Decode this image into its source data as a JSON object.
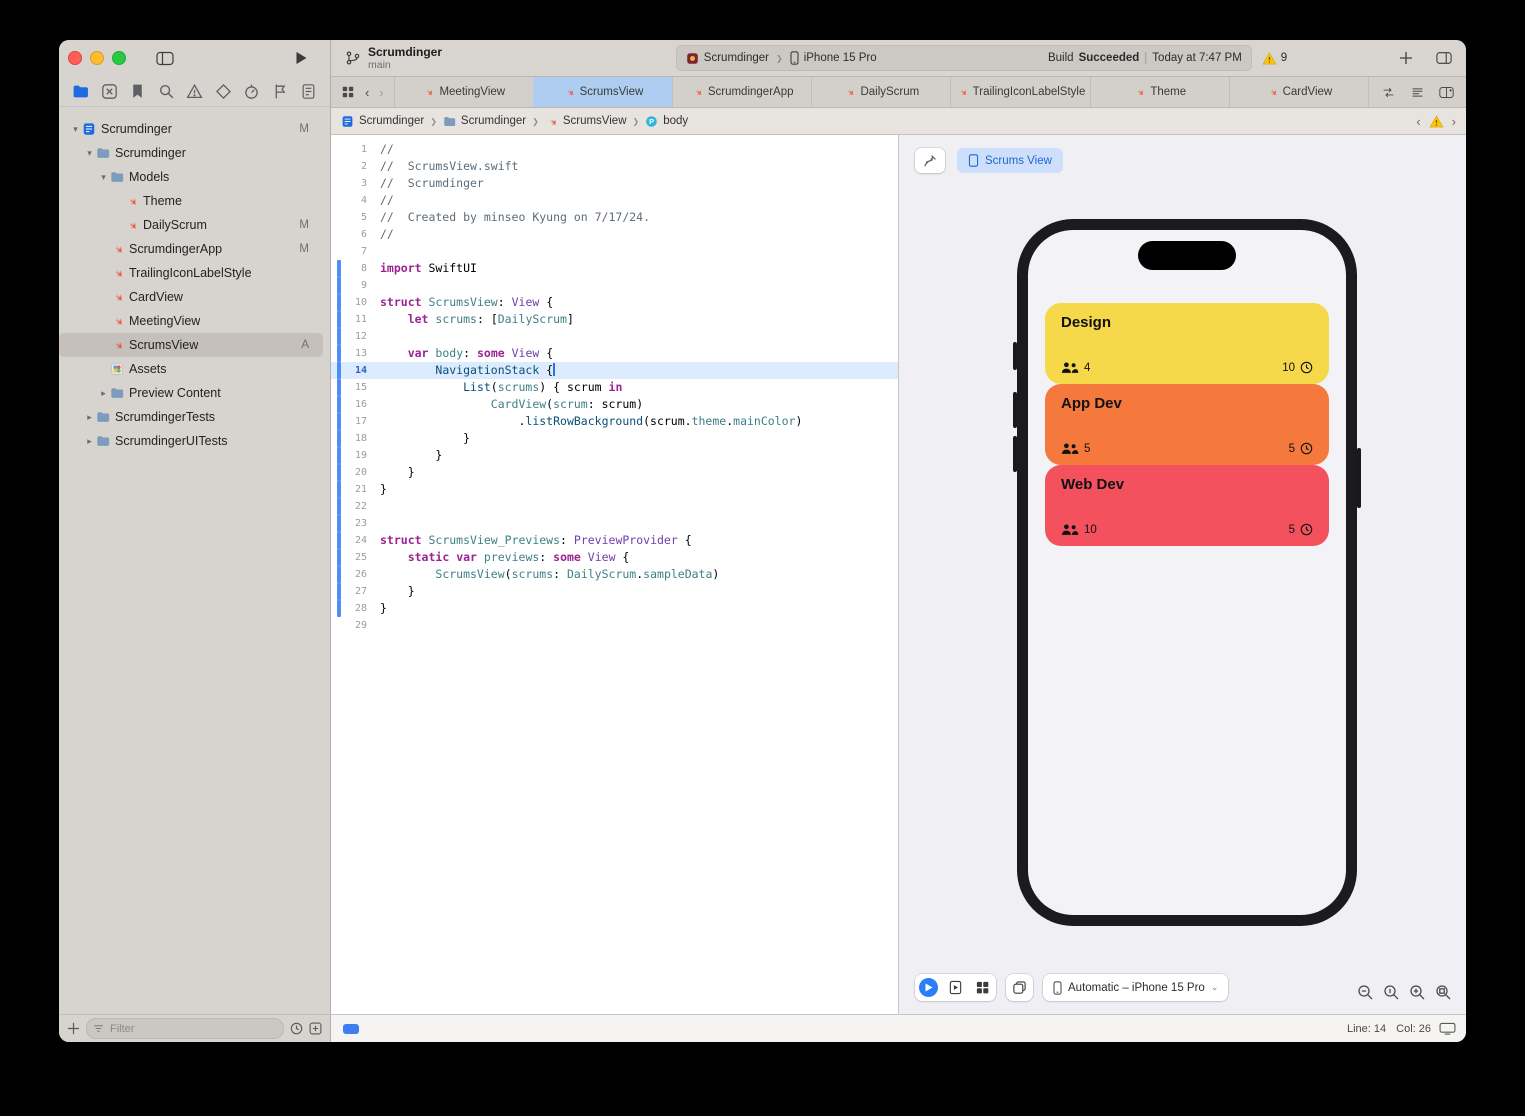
{
  "toolbar": {
    "project": "Scrumdinger",
    "branch": "main",
    "scheme": "Scrumdinger",
    "destination": "iPhone 15 Pro",
    "build_label": "Build",
    "build_status": "Succeeded",
    "build_sep": "|",
    "build_time": "Today at 7:47 PM",
    "warning_count": "9",
    "separator": "❯"
  },
  "sidebar": {
    "filter_placeholder": "Filter",
    "selected_navigator": 0,
    "navigators": [
      "nav-project",
      "nav-vcs",
      "nav-bookmark",
      "nav-find",
      "nav-issues",
      "nav-tests",
      "nav-debug",
      "nav-breakpoint",
      "nav-report"
    ],
    "items": [
      {
        "label": "Scrumdinger",
        "icon": "project",
        "depth": 0,
        "chevron": "down",
        "badge": "M"
      },
      {
        "label": "Scrumdinger",
        "icon": "folder",
        "depth": 1,
        "chevron": "down"
      },
      {
        "label": "Models",
        "icon": "folder",
        "depth": 2,
        "chevron": "down"
      },
      {
        "label": "Theme",
        "icon": "swift-file",
        "depth": 3
      },
      {
        "label": "DailyScrum",
        "icon": "swift-file",
        "depth": 3,
        "badge": "M"
      },
      {
        "label": "ScrumdingerApp",
        "icon": "swift-file",
        "depth": 2,
        "badge": "M"
      },
      {
        "label": "TrailingIconLabelStyle",
        "icon": "swift-file",
        "depth": 2
      },
      {
        "label": "CardView",
        "icon": "swift-file",
        "depth": 2
      },
      {
        "label": "MeetingView",
        "icon": "swift-file",
        "depth": 2
      },
      {
        "label": "ScrumsView",
        "icon": "swift-file",
        "depth": 2,
        "badge": "A",
        "selected": true
      },
      {
        "label": "Assets",
        "icon": "assets",
        "depth": 2
      },
      {
        "label": "Preview Content",
        "icon": "folder",
        "depth": 2,
        "chevron": "right"
      },
      {
        "label": "ScrumdingerTests",
        "icon": "folder",
        "depth": 1,
        "chevron": "right"
      },
      {
        "label": "ScrumdingerUITests",
        "icon": "folder",
        "depth": 1,
        "chevron": "right"
      }
    ]
  },
  "tabs": {
    "items": [
      {
        "label": "MeetingView"
      },
      {
        "label": "ScrumsView",
        "active": true
      },
      {
        "label": "ScrumdingerApp"
      },
      {
        "label": "DailyScrum"
      },
      {
        "label": "TrailingIconLabelStyle"
      },
      {
        "label": "Theme"
      },
      {
        "label": "CardView"
      }
    ]
  },
  "jumpbar": {
    "separator": "❯",
    "crumbs": [
      {
        "label": "Scrumdinger",
        "icon": "project"
      },
      {
        "label": "Scrumdinger",
        "icon": "folder"
      },
      {
        "label": "ScrumsView",
        "icon": "swift-file"
      },
      {
        "label": "body",
        "icon": "symbol-p"
      }
    ]
  },
  "editor": {
    "current_line": 14,
    "lines": [
      {
        "t": [
          [
            "cm",
            "//"
          ]
        ]
      },
      {
        "t": [
          [
            "cm",
            "//  ScrumsView.swift"
          ]
        ]
      },
      {
        "t": [
          [
            "cm",
            "//  Scrumdinger"
          ]
        ]
      },
      {
        "t": [
          [
            "cm",
            "//"
          ]
        ]
      },
      {
        "t": [
          [
            "cm",
            "//  Created by minseo Kyung on 7/17/24."
          ]
        ]
      },
      {
        "t": [
          [
            "cm",
            "//"
          ]
        ]
      },
      {
        "t": []
      },
      {
        "t": [
          [
            "kw",
            "import"
          ],
          [
            "pl",
            " SwiftUI"
          ]
        ],
        "chg": true
      },
      {
        "t": [],
        "chg": true
      },
      {
        "t": [
          [
            "kw",
            "struct"
          ],
          [
            "pl",
            " "
          ],
          [
            "pr",
            "ScrumsView"
          ],
          [
            "pl",
            ": "
          ],
          [
            "ty",
            "View"
          ],
          [
            "pl",
            " {"
          ]
        ],
        "chg": true
      },
      {
        "t": [
          [
            "pl",
            "    "
          ],
          [
            "kw",
            "let"
          ],
          [
            "pl",
            " "
          ],
          [
            "pr",
            "scrums"
          ],
          [
            "pl",
            ": ["
          ],
          [
            "pr",
            "DailyScrum"
          ],
          [
            "pl",
            "]"
          ]
        ],
        "chg": true
      },
      {
        "t": [],
        "chg": true
      },
      {
        "t": [
          [
            "pl",
            "    "
          ],
          [
            "kw",
            "var"
          ],
          [
            "pl",
            " "
          ],
          [
            "pr",
            "body"
          ],
          [
            "pl",
            ": "
          ],
          [
            "kw",
            "some"
          ],
          [
            "pl",
            " "
          ],
          [
            "ty",
            "View"
          ],
          [
            "pl",
            " {"
          ]
        ],
        "chg": true
      },
      {
        "t": [
          [
            "pl",
            "        "
          ],
          [
            "fn",
            "NavigationStack"
          ],
          [
            "pl",
            " {"
          ]
        ],
        "chg": true,
        "cur": true,
        "caret": true
      },
      {
        "t": [
          [
            "pl",
            "            "
          ],
          [
            "fn",
            "List"
          ],
          [
            "pl",
            "("
          ],
          [
            "pr",
            "scrums"
          ],
          [
            "pl",
            ") { scrum "
          ],
          [
            "kw",
            "in"
          ]
        ],
        "chg": true
      },
      {
        "t": [
          [
            "pl",
            "                "
          ],
          [
            "pr",
            "CardView"
          ],
          [
            "pl",
            "("
          ],
          [
            "pr",
            "scrum"
          ],
          [
            "pl",
            ": scrum)"
          ]
        ],
        "chg": true
      },
      {
        "t": [
          [
            "pl",
            "                    ."
          ],
          [
            "fn",
            "listRowBackground"
          ],
          [
            "pl",
            "(scrum."
          ],
          [
            "pr",
            "theme"
          ],
          [
            "pl",
            "."
          ],
          [
            "pr",
            "mainColor"
          ],
          [
            "pl",
            ")"
          ]
        ],
        "chg": true
      },
      {
        "t": [
          [
            "pl",
            "            }"
          ]
        ],
        "chg": true
      },
      {
        "t": [
          [
            "pl",
            "        }"
          ]
        ],
        "chg": true
      },
      {
        "t": [
          [
            "pl",
            "    }"
          ]
        ],
        "chg": true
      },
      {
        "t": [
          [
            "pl",
            "}"
          ]
        ],
        "chg": true
      },
      {
        "t": [],
        "chg": true
      },
      {
        "t": [],
        "chg": true
      },
      {
        "t": [
          [
            "kw",
            "struct"
          ],
          [
            "pl",
            " "
          ],
          [
            "pr",
            "ScrumsView_Previews"
          ],
          [
            "pl",
            ": "
          ],
          [
            "ty",
            "PreviewProvider"
          ],
          [
            "pl",
            " {"
          ]
        ],
        "chg": true
      },
      {
        "t": [
          [
            "pl",
            "    "
          ],
          [
            "kw",
            "static"
          ],
          [
            "pl",
            " "
          ],
          [
            "kw",
            "var"
          ],
          [
            "pl",
            " "
          ],
          [
            "pr",
            "previews"
          ],
          [
            "pl",
            ": "
          ],
          [
            "kw",
            "some"
          ],
          [
            "pl",
            " "
          ],
          [
            "ty",
            "View"
          ],
          [
            "pl",
            " {"
          ]
        ],
        "chg": true
      },
      {
        "t": [
          [
            "pl",
            "        "
          ],
          [
            "pr",
            "ScrumsView"
          ],
          [
            "pl",
            "("
          ],
          [
            "pr",
            "scrums"
          ],
          [
            "pl",
            ": "
          ],
          [
            "pr",
            "DailyScrum"
          ],
          [
            "pl",
            "."
          ],
          [
            "pr",
            "sampleData"
          ],
          [
            "pl",
            ")"
          ]
        ],
        "chg": true
      },
      {
        "t": [
          [
            "pl",
            "    }"
          ]
        ],
        "chg": true
      },
      {
        "t": [
          [
            "pl",
            "}"
          ]
        ],
        "chg": true
      },
      {
        "t": []
      }
    ]
  },
  "preview": {
    "tab_label": "Scrums View",
    "device_menu": "Automatic – iPhone 15 Pro",
    "cards": [
      {
        "title": "Design",
        "attendees": "4",
        "minutes": "10",
        "color": "#F6D84B"
      },
      {
        "title": "App Dev",
        "attendees": "5",
        "minutes": "5",
        "color": "#F5793D"
      },
      {
        "title": "Web Dev",
        "attendees": "10",
        "minutes": "5",
        "color": "#F4515E"
      }
    ]
  },
  "statusbar": {
    "line": "Line: 14",
    "col": "Col: 26"
  }
}
